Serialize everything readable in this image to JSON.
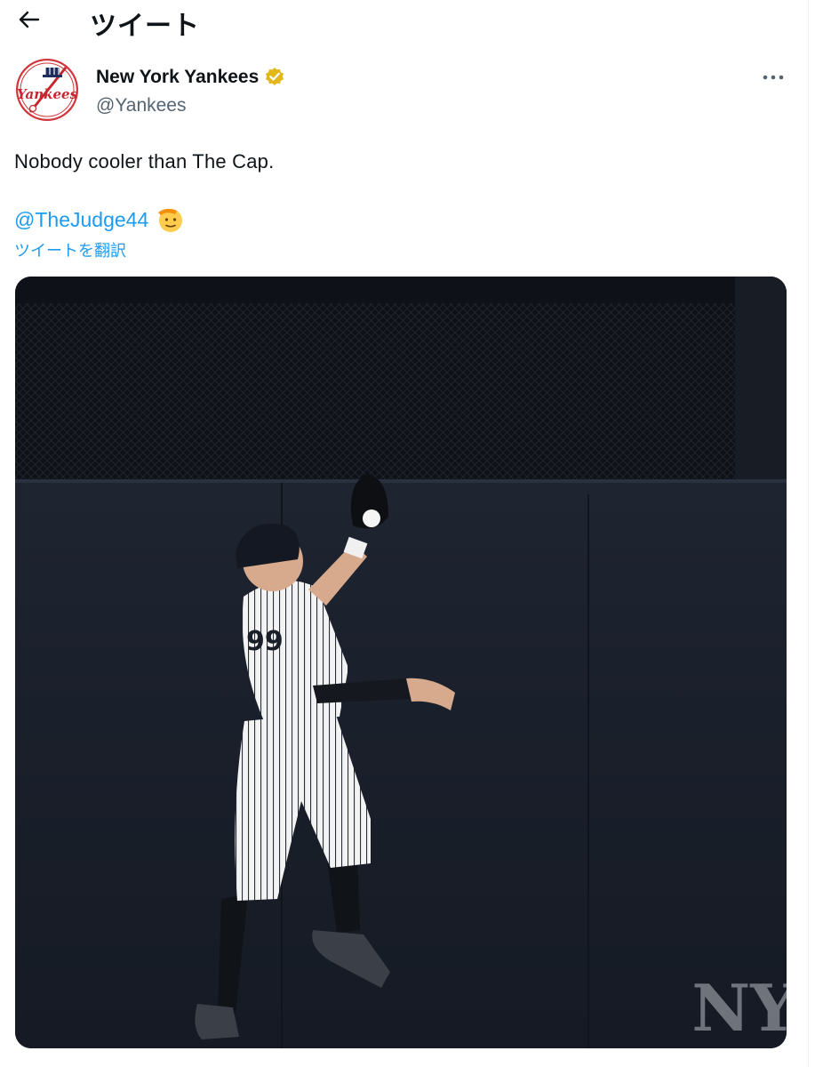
{
  "header": {
    "title": "ツイート"
  },
  "author": {
    "display_name": "New York Yankees",
    "handle": "@Yankees",
    "verified_color": "#e2b719",
    "logo_text": "Yankees"
  },
  "tweet": {
    "text": "Nobody cooler than The Cap.",
    "mention": "@TheJudge44",
    "emoji": "saluting-face-emoji",
    "translate_label": "ツイートを翻訳"
  },
  "media": {
    "jersey_number": "99",
    "watermark": "NY",
    "colors": {
      "wall": "#1b212d",
      "net": "#0e1118",
      "uniform": "#f2f2f2"
    }
  },
  "colors": {
    "link": "#1d9bf0",
    "secondary_text": "#536471",
    "text": "#0f1419"
  }
}
